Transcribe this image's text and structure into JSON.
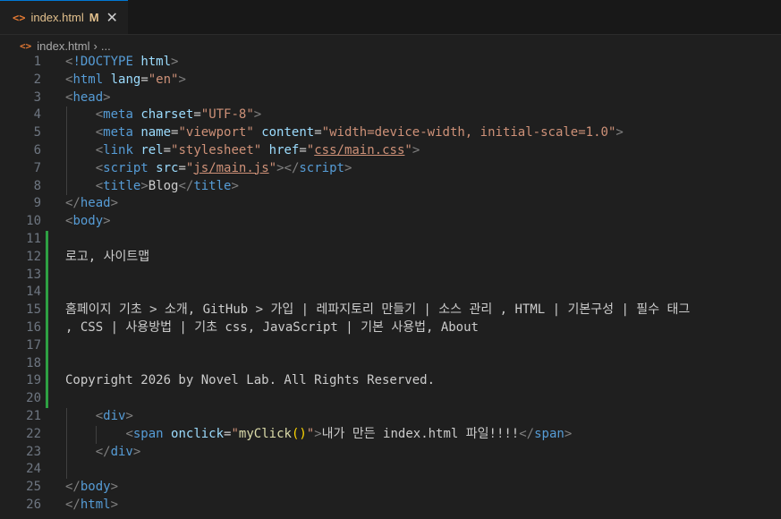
{
  "tab": {
    "icon": "<>",
    "filename": "index.html",
    "modified": "M",
    "close": "✕"
  },
  "breadcrumb": {
    "file": "index.html",
    "sep": "›",
    "more": "..."
  },
  "lines": [
    {
      "n": "1"
    },
    {
      "n": "2"
    },
    {
      "n": "3"
    },
    {
      "n": "4"
    },
    {
      "n": "5"
    },
    {
      "n": "6"
    },
    {
      "n": "7"
    },
    {
      "n": "8"
    },
    {
      "n": "9"
    },
    {
      "n": "10"
    },
    {
      "n": "11"
    },
    {
      "n": "12"
    },
    {
      "n": "13"
    },
    {
      "n": "14"
    },
    {
      "n": "15"
    },
    {
      "n": "16"
    },
    {
      "n": "17"
    },
    {
      "n": "18"
    },
    {
      "n": "19"
    },
    {
      "n": "20"
    },
    {
      "n": "21"
    },
    {
      "n": "22"
    },
    {
      "n": "23"
    },
    {
      "n": "24"
    },
    {
      "n": "25"
    },
    {
      "n": "26"
    }
  ],
  "code": {
    "l1_lt": "<",
    "l1_doctype": "!DOCTYPE",
    "l1_html": "html",
    "l1_gt": ">",
    "l2_lt": "<",
    "l2_tag": "html",
    "l2_attr": "lang",
    "l2_eq": "=",
    "l2_val": "\"en\"",
    "l2_gt": ">",
    "l3_lt": "<",
    "l3_tag": "head",
    "l3_gt": ">",
    "l4_lt": "<",
    "l4_tag": "meta",
    "l4_attr": "charset",
    "l4_eq": "=",
    "l4_val": "\"UTF-8\"",
    "l4_gt": ">",
    "l5_lt": "<",
    "l5_tag": "meta",
    "l5_attr1": "name",
    "l5_eq1": "=",
    "l5_val1": "\"viewport\"",
    "l5_attr2": "content",
    "l5_eq2": "=",
    "l5_val2": "\"width=device-width, initial-scale=1.0\"",
    "l5_gt": ">",
    "l6_lt": "<",
    "l6_tag": "link",
    "l6_attr1": "rel",
    "l6_eq1": "=",
    "l6_val1": "\"stylesheet\"",
    "l6_attr2": "href",
    "l6_eq2": "=",
    "l6_q1": "\"",
    "l6_link": "css/main.css",
    "l6_q2": "\"",
    "l6_gt": ">",
    "l7_lt": "<",
    "l7_tag": "script",
    "l7_attr": "src",
    "l7_eq": "=",
    "l7_q1": "\"",
    "l7_link": "js/main.js",
    "l7_q2": "\"",
    "l7_gt": ">",
    "l7_close_lt": "</",
    "l7_close_tag": "script",
    "l7_close_gt": ">",
    "l8_lt": "<",
    "l8_tag": "title",
    "l8_gt": ">",
    "l8_text": "Blog",
    "l8_close_lt": "</",
    "l8_close_tag": "title",
    "l8_close_gt": ">",
    "l9_lt": "</",
    "l9_tag": "head",
    "l9_gt": ">",
    "l10_lt": "<",
    "l10_tag": "body",
    "l10_gt": ">",
    "l12_text": "로고, 사이트맵",
    "l15_text": "홈페이지 기초 > 소개, GitHub > 가입 | 레파지토리 만들기 | 소스 관리 , HTML | 기본구성 | 필수 태그",
    "l16_text": ", CSS | 사용방법 | 기초 css, JavaScript | 기본 사용법, About",
    "l19_text": "Copyright 2026 by Novel Lab. All Rights Reserved.",
    "l21_lt": "<",
    "l21_tag": "div",
    "l21_gt": ">",
    "l22_lt": "<",
    "l22_tag": "span",
    "l22_attr": "onclick",
    "l22_eq": "=",
    "l22_q1": "\"",
    "l22_fn": "myClick",
    "l22_paren": "()",
    "l22_q2": "\"",
    "l22_gt": ">",
    "l22_text": "내가 만든 index.html 파일!!!!",
    "l22_close_lt": "</",
    "l22_close_tag": "span",
    "l22_close_gt": ">",
    "l23_lt": "</",
    "l23_tag": "div",
    "l23_gt": ">",
    "l25_lt": "</",
    "l25_tag": "body",
    "l25_gt": ">",
    "l26_lt": "</",
    "l26_tag": "html",
    "l26_gt": ">"
  }
}
